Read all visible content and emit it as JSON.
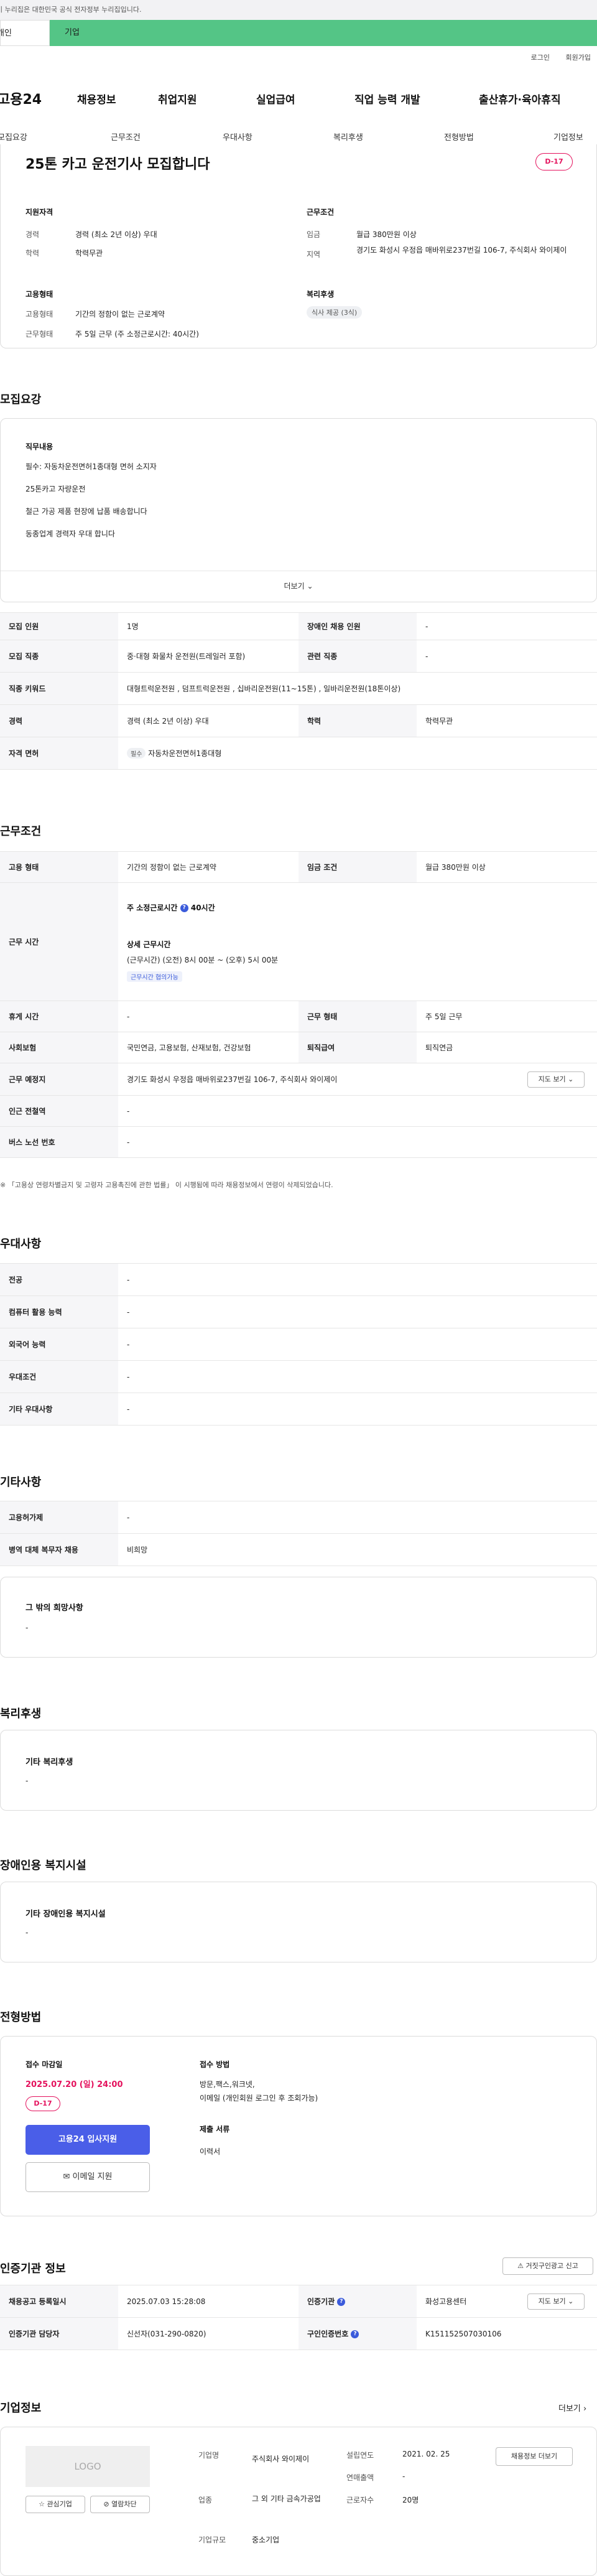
{
  "gov_banner": "이 누리집은 대한민국 공식 전자정부 누리집입니다.",
  "gov_tabs": [
    "개인",
    "기업"
  ],
  "util_links": [
    "로그인",
    "회원가입"
  ],
  "logo": "고용24",
  "gnb": [
    "채용정보",
    "취업지원",
    "실업급여",
    "직업 능력 개발",
    "출산휴가·육아휴직"
  ],
  "subtabs": [
    "모집요강",
    "근무조건",
    "우대사항",
    "복리후생",
    "전형방법",
    "기업정보"
  ],
  "summary": {
    "title": "25톤 카고 운전기사 모집합니다",
    "dday": "D-17",
    "qual_title": "지원자격",
    "cond_title": "근무조건",
    "career_label": "경력",
    "career_value": "경력 (최소 2년 이상) 우대",
    "edu_label": "학력",
    "edu_value": "학력무관",
    "wage_label": "임금",
    "wage_value": "월급 380만원 이상",
    "region_label": "지역",
    "region_value": "경기도 화성시 우정읍 매바위로237번길 106-7, 주식회사 와이제이",
    "emp_title": "고용형태",
    "emptype_label": "고용형태",
    "emptype_value": "기간의 정함이 없는 근로계약",
    "work_label": "근무형태",
    "work_value": "주 5일 근무 (주 소정근로시간: 40시간)",
    "welfare_title": "복리후생",
    "welfare_pill": "식사 제공 (3식)"
  },
  "recruit": {
    "heading": "모집요강",
    "duty_title": "직무내용",
    "duty_lines": [
      "필수: 자동차운전면허1종대형 면허 소지자",
      "25톤카고 자량운전",
      "철근 가공 제품 현장에 납품 배송합니다",
      "동종업계 경력자 우대 합니다"
    ],
    "more": "더보기",
    "rows": [
      [
        "모집 인원",
        "1명",
        "장애인 채용 인원",
        "-"
      ],
      [
        "모집 직종",
        "중·대형 화물차 운전원(트레일러 포함)",
        "관련 직종",
        "-"
      ],
      [
        "직종 키워드",
        "대형트럭운전원 , 덤프트럭운전원 , 십바리운전원(11~15톤) , 일바리운전원(18톤이상)",
        "",
        ""
      ],
      [
        "경력",
        "경력 (최소 2년 이상) 우대",
        "학력",
        "학력무관"
      ]
    ],
    "license_label": "자격 면허",
    "license_tag": "필수",
    "license_value": "자동차운전면허1종대형"
  },
  "conditions": {
    "heading": "근무조건",
    "emptype_label": "고용 형태",
    "emptype_value": "기간의 정함이 없는 근로계약",
    "wagecond_label": "임금 조건",
    "wagecond_value": "월급 380만원 이상",
    "hours_label": "근무 시간",
    "hours_week": "주 소정근로시간",
    "hours_week_value": "40시간",
    "hours_detail_title": "상세 근무시간",
    "hours_detail": "(근무시간) (오전) 8시 00분 ~ (오후) 5시 00분",
    "hours_tag": "근무시간 협의가능",
    "rest_label": "휴게 시간",
    "rest_value": "-",
    "workform_label": "근무 형태",
    "workform_value": "주 5일 근무",
    "insurance_label": "사회보험",
    "insurance_value": "국민연금, 고용보험, 산재보험, 건강보험",
    "severance_label": "퇴직급여",
    "severance_value": "퇴직연금",
    "place_label": "근무 예정지",
    "place_value": "경기도 화성시 우정읍 매바위로237번길 106-7, 주식회사 와이제이",
    "map_btn": "지도 보기",
    "station_label": "인근 전철역",
    "station_value": "-",
    "bus_label": "버스 노선 번호",
    "bus_value": "-",
    "note": "※ 「고용상 연령차별금지 및 고령자 고용촉진에 관한 법률」 이 시행됨에 따라 채용정보에서 연령이 삭제되었습니다."
  },
  "pref": {
    "heading": "우대사항",
    "rows": [
      [
        "전공",
        "-"
      ],
      [
        "컴퓨터 활용 능력",
        "-"
      ],
      [
        "외국어 능력",
        "-"
      ],
      [
        "우대조건",
        "-"
      ],
      [
        "기타 우대사항",
        "-"
      ]
    ]
  },
  "etc": {
    "heading": "기타사항",
    "rows": [
      [
        "고용허가제",
        "-"
      ],
      [
        "병역 대체 복무자 채용",
        "비희망"
      ]
    ],
    "other_title": "그 밖의 희망사항",
    "other_value": "-"
  },
  "welfare": {
    "heading": "복리후생",
    "box_title": "기타 복리후생",
    "box_value": "-"
  },
  "disabled": {
    "heading": "장애인용 복지시설",
    "box_title": "기타 장애인용 복지시설",
    "box_value": "-"
  },
  "screening": {
    "heading": "전형방법",
    "deadline_title": "접수 마감일",
    "deadline": "2025.07.20 (일) 24:00",
    "dday": "D-17",
    "apply_btn": "고용24 입사지원",
    "email_btn": "이메일 지원",
    "method_title": "접수 방법",
    "method_lines": [
      "방문,팩스,워크넷,",
      "이메일 (개인회원 로그인 후 조회가능)"
    ],
    "docs_title": "제출 서류",
    "docs_value": "이력서"
  },
  "cert": {
    "heading": "인증기관 정보",
    "report_btn": "거짓구인광고 신고",
    "reg_label": "채용공고 등록일시",
    "reg_value": "2025.07.03 15:28:08",
    "agency_label": "인증기관",
    "agency_value": "화성고용센터",
    "map_btn": "지도 보기",
    "manager_label": "인증기관 담당자",
    "manager_value": "신선자(031-290-0820)",
    "num_label": "구인인증번호",
    "num_value": "K151152507030106"
  },
  "company": {
    "heading": "기업정보",
    "more": "더보기",
    "logo_text": "LOGO",
    "fav_btn": "관심기업",
    "block_btn": "열람차단",
    "name_label": "기업명",
    "name_value": "주식회사 와이제이",
    "industry_label": "업종",
    "industry_value": "그 외 기타 금속가공업",
    "size_label": "기업규모",
    "size_value": "중소기업",
    "founded_label": "설립연도",
    "founded_value": "2021. 02. 25",
    "sales_label": "연매출액",
    "sales_value": "-",
    "staff_label": "근로자수",
    "staff_value": "20명",
    "recruit_btn": "채용정보 더보기"
  }
}
